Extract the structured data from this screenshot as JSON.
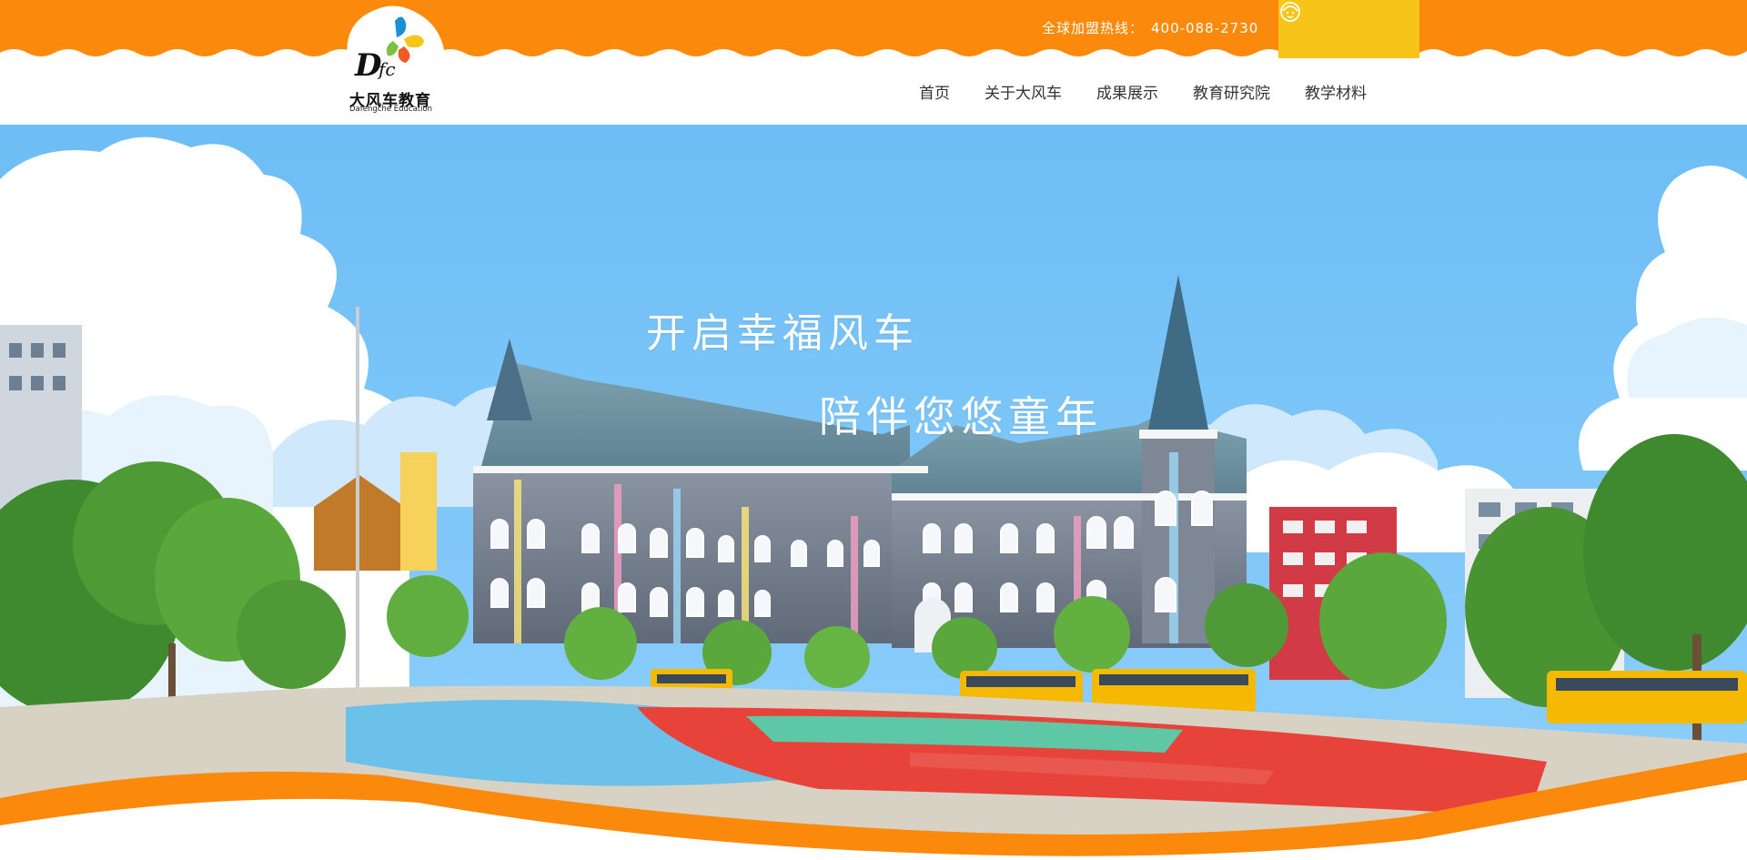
{
  "brand": {
    "name": "大风车教育",
    "subtitle": "Dafengche Education",
    "logo_letters": "DFC",
    "colors": {
      "orange": "#fb8a0c",
      "yellow": "#f7c41a",
      "sky": "#71bff5"
    }
  },
  "header": {
    "hotline_label": "全球加盟热线：",
    "hotline_number": "400-088-2730",
    "service_icon": "customer-service-icon"
  },
  "nav": {
    "items": [
      {
        "label": "首页"
      },
      {
        "label": "关于大风车"
      },
      {
        "label": "成果展示"
      },
      {
        "label": "教育研究院"
      },
      {
        "label": "教学材料"
      }
    ]
  },
  "hero": {
    "slogan_line1": "开启幸福风车",
    "slogan_line2": "陪伴您悠童年"
  }
}
